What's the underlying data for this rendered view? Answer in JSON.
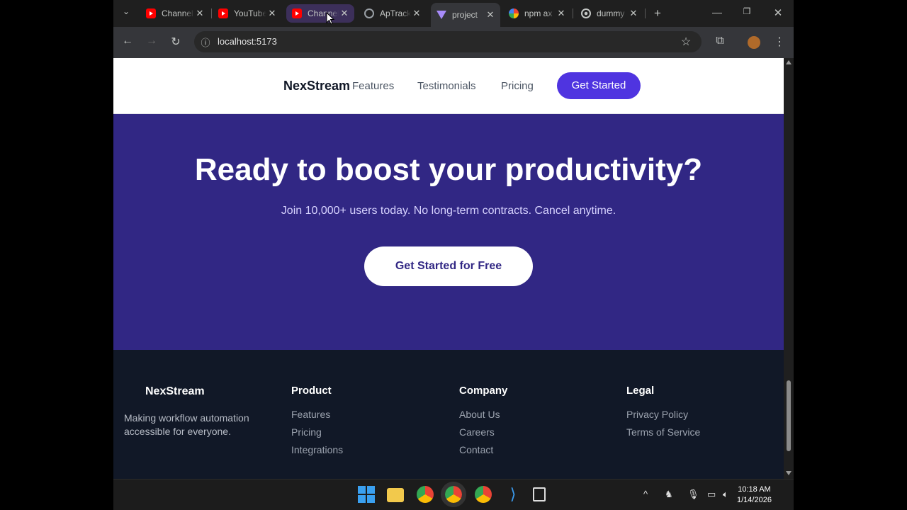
{
  "browser": {
    "tabs": [
      {
        "title": "Channel"
      },
      {
        "title": "YouTube"
      },
      {
        "title": "Channel"
      },
      {
        "title": "ApTrack"
      },
      {
        "title": "project"
      },
      {
        "title": "npm ax"
      },
      {
        "title": "dummy"
      }
    ],
    "new_tab_symbol": "+",
    "url": "localhost:5173"
  },
  "page": {
    "nav": {
      "brand": "NexStream",
      "links": [
        "Features",
        "Testimonials",
        "Pricing"
      ],
      "cta": "Get Started"
    },
    "hero": {
      "headline": "Ready to boost your productivity?",
      "subline": "Join 10,000+ users today. No long-term contracts. Cancel anytime.",
      "button": "Get Started for Free"
    },
    "footer": {
      "brand": "NexStream",
      "tagline": "Making workflow automation accessible for everyone.",
      "columns": [
        {
          "heading": "Product",
          "links": [
            "Features",
            "Pricing",
            "Integrations"
          ]
        },
        {
          "heading": "Company",
          "links": [
            "About Us",
            "Careers",
            "Contact"
          ]
        },
        {
          "heading": "Legal",
          "links": [
            "Privacy Policy",
            "Terms of Service"
          ]
        }
      ]
    }
  },
  "taskbar": {
    "time": "10:18 AM",
    "date": "1/14/2026"
  },
  "colors": {
    "accent": "#4f34e0",
    "hero_bg": "#312784",
    "footer_bg": "#111827"
  }
}
